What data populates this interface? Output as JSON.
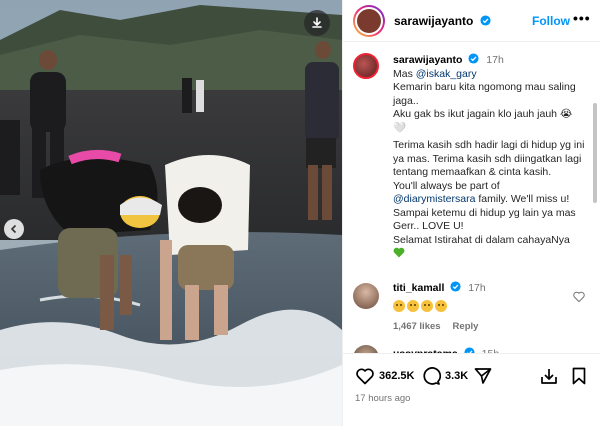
{
  "post": {
    "username": "sarawijayanto",
    "follow_label": "Follow",
    "more_label": "•••"
  },
  "caption": {
    "username": "sarawijayanto",
    "time": "17h",
    "lines": [
      "Mas ",
      "Kemarin baru kita ngomong mau saling jaga..",
      "Aku gak bs ikut jagain klo jauh jauh 😭",
      "🤍",
      "Terima kasih sdh hadir lagi di hidup yg ini ya mas. Terima kasih sdh diingatkan lagi tentang memaafkan & cinta kasih.",
      "You'll always be part of ",
      " family. We'll miss u!",
      "Sampai ketemu di hidup yg lain ya mas Gerr.. LOVE U!",
      "Selamat Istirahat di dalam cahayaNya"
    ],
    "mention_1": "@iskak_gary",
    "mention_2": "@diarymistersara"
  },
  "comments": [
    {
      "username": "titi_kamall",
      "time": "17h",
      "likes": "1,467 likes",
      "reply": "Reply"
    },
    {
      "username": "ussypratama",
      "time": "15h"
    }
  ],
  "actions": {
    "likes_count": "362.5K",
    "comments_count": "3.3K",
    "posted_ago": "17 hours ago"
  },
  "icons": [
    "download-icon",
    "chevron-left-icon",
    "verified-icon",
    "more-icon",
    "heart-icon",
    "comment-icon",
    "share-icon",
    "repost-icon",
    "bookmark-icon"
  ],
  "colors": {
    "accent": "#0095f6",
    "verified": "#0095f6",
    "muted": "#737373"
  }
}
